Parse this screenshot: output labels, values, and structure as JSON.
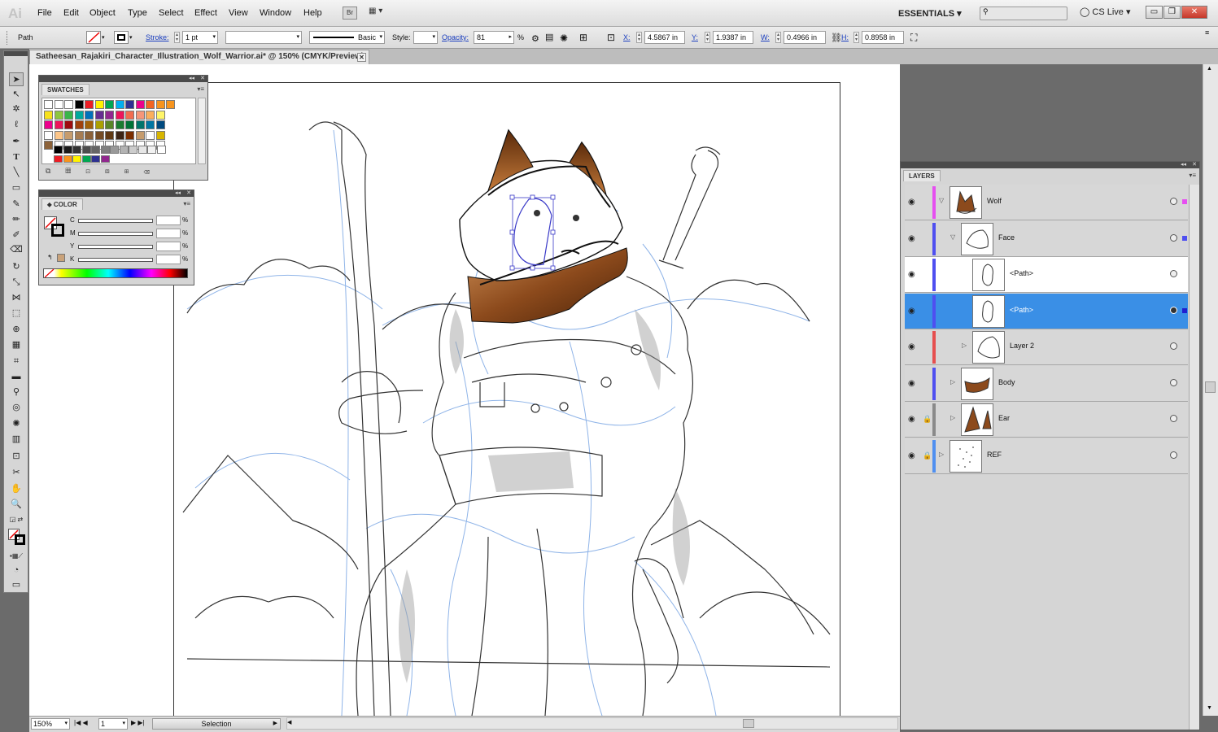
{
  "app": {
    "logo": "Ai",
    "menus": [
      "File",
      "Edit",
      "Object",
      "Type",
      "Select",
      "Effect",
      "View",
      "Window",
      "Help"
    ],
    "bridge_label": "Br",
    "workspace": "ESSENTIALS",
    "cs_live": "CS Live",
    "window_buttons": [
      "▭",
      "❐",
      "✕"
    ]
  },
  "controlbar": {
    "selection_type": "Path",
    "stroke_label": "Stroke:",
    "stroke_weight": "1 pt",
    "brush_profile": "Basic",
    "style_label": "Style:",
    "opacity_label": "Opacity:",
    "opacity_value": "81",
    "opacity_unit": "%",
    "x_label": "X:",
    "x_value": "4.5867 in",
    "y_label": "Y:",
    "y_value": "1.9387 in",
    "w_label": "W:",
    "w_value": "0.4966 in",
    "h_label": "H:",
    "h_value": "0.8958 in"
  },
  "document": {
    "tab_title": "Satheesan_Rajakiri_Character_Illustration_Wolf_Warrior.ai* @ 150% (CMYK/Preview)"
  },
  "status": {
    "zoom": "150%",
    "page": "1",
    "tool": "Selection"
  },
  "swatches_panel": {
    "title": "SWATCHES",
    "rows": [
      [
        "#ffffff",
        "#ffffff",
        "#ffffff",
        "#000000",
        "#ed1c24",
        "#fff200",
        "#00a651",
        "#00aeef",
        "#2e3192",
        "#ec008c",
        "#f26522",
        "#f7941d",
        "#f7941d"
      ],
      [
        "#f7e11d",
        "#8dc63f",
        "#39b54a",
        "#00a99d",
        "#0072bc",
        "#662d91",
        "#92278f",
        "#ed145b",
        "#f26c4f",
        "#f69679",
        "#fbaf5d",
        "#fff568"
      ],
      [
        "#ec008c",
        "#ed145b",
        "#9e0b0f",
        "#a0410d",
        "#a36209",
        "#aba000",
        "#598527",
        "#1a7b30",
        "#007236",
        "#00746b",
        "#0076a3",
        "#004a80"
      ],
      [
        "#ffffff",
        "#fdc689",
        "#c69c6d",
        "#a67c52",
        "#8c6239",
        "#754c24",
        "#603913",
        "#3c2415",
        "#7b2e00",
        "#c69c6d",
        "#ffffff",
        "#d7b500"
      ],
      [
        "#8c6239",
        "#ffffff",
        "#ffffff",
        "#ffffff",
        "#ffffff",
        "#ffffff",
        "#ffffff",
        "#ffffff",
        "#ffffff",
        "#ffffff",
        "#ffffff",
        "#ffffff"
      ]
    ],
    "grays": [
      "#000000",
      "#1a1a1a",
      "#333333",
      "#4d4d4d",
      "#666666",
      "#808080",
      "#999999",
      "#b3b3b3",
      "#cccccc",
      "#e6e6e6",
      "#f2f2f2",
      "#ffffff"
    ],
    "group": [
      "#ed1c24",
      "#f7941d",
      "#fff200",
      "#00a651",
      "#2e3192",
      "#92278f"
    ]
  },
  "color_panel": {
    "title": "COLOR",
    "channels": [
      "C",
      "M",
      "Y",
      "K"
    ],
    "pct": "%"
  },
  "layers_panel": {
    "title": "LAYERS",
    "rows": [
      {
        "name": "Wolf",
        "indent": 0,
        "color": "#e64ff0",
        "expanded": true,
        "locked": false,
        "selected": false,
        "sel_color": "#e64ff0"
      },
      {
        "name": "Face",
        "indent": 1,
        "color": "#4f4ff0",
        "expanded": true,
        "locked": false,
        "selected": false,
        "sel_color": "#4f4ff0"
      },
      {
        "name": "<Path>",
        "indent": 2,
        "color": "#4f4ff0",
        "expanded": false,
        "locked": false,
        "selected": false,
        "sel_color": ""
      },
      {
        "name": "<Path>",
        "indent": 2,
        "color": "#4f4ff0",
        "expanded": false,
        "locked": false,
        "selected": true,
        "sel_color": "#1f1fd0"
      },
      {
        "name": "Layer 2",
        "indent": 2,
        "color": "#e64f4f",
        "expanded": false,
        "locked": false,
        "selected": false,
        "sel_color": ""
      },
      {
        "name": "Body",
        "indent": 1,
        "color": "#4f4ff0",
        "expanded": false,
        "locked": false,
        "selected": false,
        "sel_color": ""
      },
      {
        "name": "Ear",
        "indent": 1,
        "color": "#8a8a8a",
        "expanded": false,
        "locked": true,
        "selected": false,
        "sel_color": ""
      },
      {
        "name": "REF",
        "indent": 0,
        "color": "#4f8ff0",
        "expanded": false,
        "locked": true,
        "selected": false,
        "sel_color": ""
      }
    ]
  },
  "colors": {
    "accent": "#3a8fe6",
    "fur": "#8c4a1c",
    "sketch_blue": "#8fb4e8"
  }
}
